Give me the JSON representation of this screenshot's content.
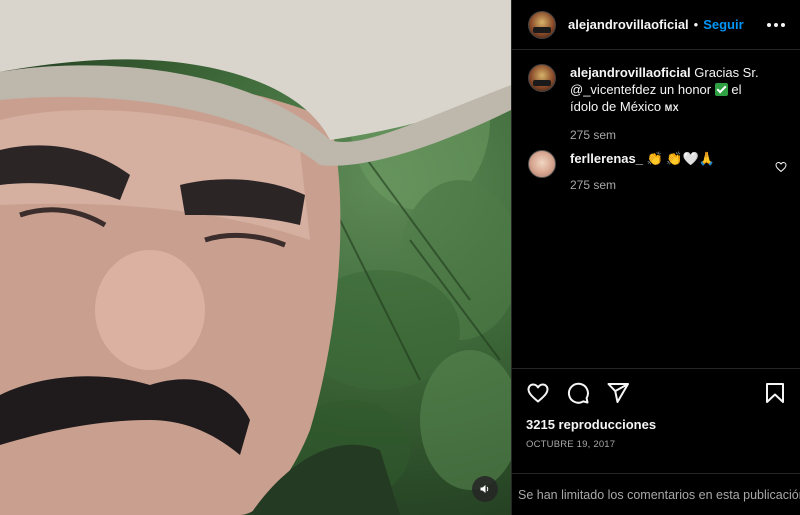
{
  "post": {
    "username": "alejandrovillaoficial",
    "follow_label": "Seguir",
    "separator": "•",
    "caption": {
      "username": "alejandrovillaoficial",
      "text_before_check": "Gracias Sr. @_vicentefdez un honor",
      "text_after_check": "el ídolo de México",
      "flag_text": "MX",
      "time": "275 sem"
    },
    "comments": [
      {
        "username": "ferllerenas_",
        "text": "👏 👏🤍🙏",
        "time": "275 sem"
      }
    ],
    "views": "3215 reproducciones",
    "date": "OCTUBRE 19, 2017",
    "comments_limited": "Se han limitado los comentarios en esta publicación."
  },
  "icons": {
    "more": "more-options-icon",
    "like": "heart-icon",
    "comment": "comment-icon",
    "share": "share-icon",
    "save": "bookmark-icon",
    "mute": "speaker-icon"
  },
  "colors": {
    "accent": "#0095f6",
    "background": "#000000",
    "secondary_text": "#a8a8a8",
    "divider": "#262626"
  }
}
